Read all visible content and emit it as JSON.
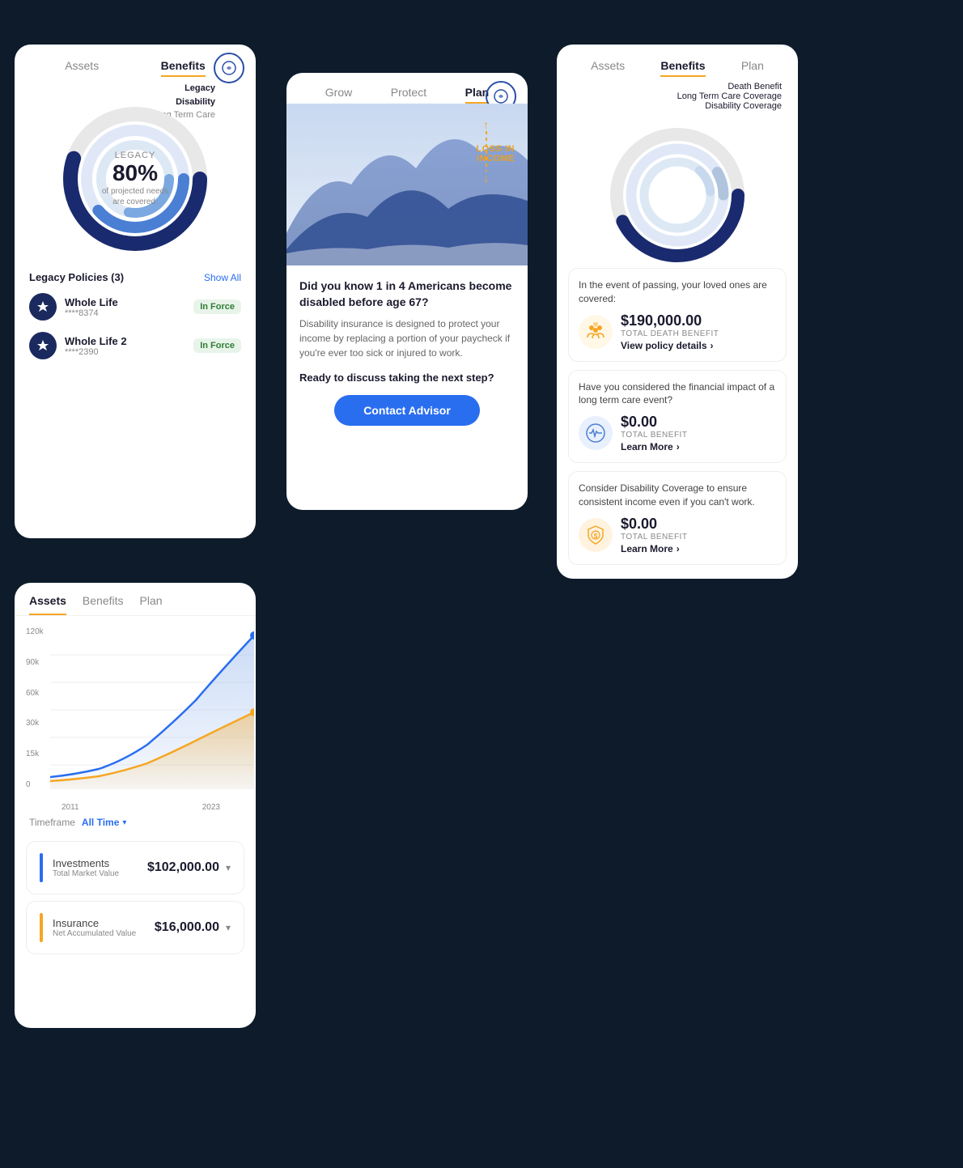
{
  "app": {
    "background": "#0d1b2a"
  },
  "card_benefits": {
    "tabs": [
      {
        "label": "Assets",
        "active": false
      },
      {
        "label": "Benefits",
        "active": true
      }
    ],
    "legend": {
      "label1": "Legacy",
      "label2": "Disability",
      "label3": "Long Term Care"
    },
    "donut": {
      "category": "LEGACY",
      "percent": "80%",
      "desc1": "of projected needs",
      "desc2": "are covered."
    },
    "policies": {
      "title": "Legacy Policies (3)",
      "show_all": "Show All",
      "items": [
        {
          "name": "Whole Life",
          "number": "****8374",
          "status": "In Force"
        },
        {
          "name": "Whole Life 2",
          "number": "****2390",
          "status": "In Force"
        }
      ]
    }
  },
  "card_plan": {
    "tabs": [
      {
        "label": "Grow",
        "active": false
      },
      {
        "label": "Protect",
        "active": false
      },
      {
        "label": "Plan",
        "active": true
      }
    ],
    "chart": {
      "loss_income_title": "LOSS IN",
      "loss_income_sub": "INCOME"
    },
    "question": "Did you know 1 in 4 Americans become disabled before age 67?",
    "description": "Disability insurance is designed to protect your income by replacing a portion of your paycheck if you're ever too sick or injured to work.",
    "discuss": "Ready to discuss taking the next step?",
    "contact_button": "Contact Advisor"
  },
  "card_benefits_right": {
    "tabs": [
      {
        "label": "Assets",
        "active": false
      },
      {
        "label": "Benefits",
        "active": true
      },
      {
        "label": "Plan",
        "active": false
      }
    ],
    "legend": {
      "label1": "Death Benefit",
      "label2": "Long Term Care Coverage",
      "label3": "Disability Coverage"
    },
    "items": [
      {
        "desc": "In the event of passing, your loved ones are covered:",
        "amount": "$190,000.00",
        "label": "TOTAL DEATH BENEFIT",
        "link": "View policy details",
        "icon_type": "people"
      },
      {
        "desc": "Have you considered the financial impact of a long term care event?",
        "amount": "$0.00",
        "label": "TOTAL BENEFIT",
        "link": "Learn More",
        "icon_type": "heart"
      },
      {
        "desc": "Consider Disability Coverage to ensure consistent income even if you can't work.",
        "amount": "$0.00",
        "label": "TOTAL BENEFIT",
        "link": "Learn More",
        "icon_type": "shield"
      }
    ]
  },
  "card_assets": {
    "tabs": [
      {
        "label": "Assets",
        "active": true
      },
      {
        "label": "Benefits",
        "active": false
      },
      {
        "label": "Plan",
        "active": false
      }
    ],
    "chart": {
      "y_labels": [
        "0",
        "15k",
        "30k",
        "60k",
        "90k",
        "120k"
      ],
      "x_labels": [
        "2011",
        "2023"
      ]
    },
    "timeframe": {
      "label": "Timeframe",
      "value": "All Time"
    },
    "items": [
      {
        "color": "blue",
        "name": "Investments",
        "amount": "$102,000.00",
        "sublabel": "Total Market Value"
      },
      {
        "color": "gold",
        "name": "Insurance",
        "amount": "$16,000.00",
        "sublabel": "Net Accumulated Value"
      }
    ]
  }
}
